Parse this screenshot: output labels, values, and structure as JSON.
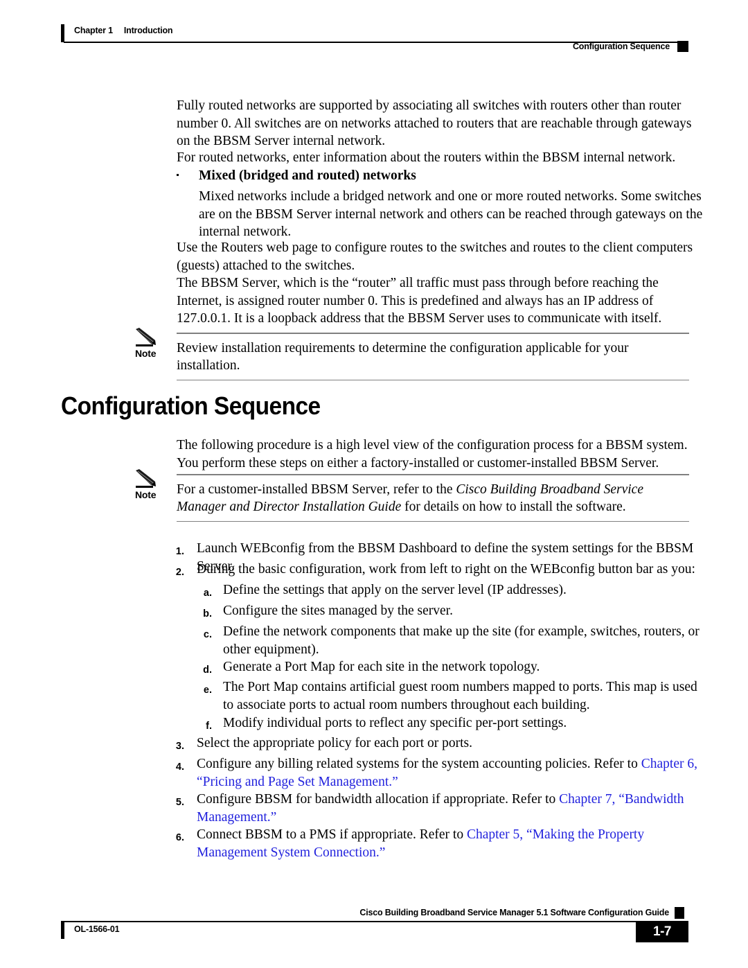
{
  "header": {
    "chapter_number": "Chapter 1",
    "chapter_title": "Introduction",
    "running_head": "Configuration Sequence"
  },
  "body": {
    "para_fully_routed": "Fully routed networks are supported by associating all switches with routers other than router number 0. All switches are on networks attached to routers that are reachable through gateways on the BBSM Server internal network.",
    "para_for_routed": "For routed networks, enter information about the routers within the BBSM internal network.",
    "bullet_mixed_title": "Mixed (bridged and routed) networks",
    "para_mixed_body": "Mixed networks include a bridged network and one or more routed networks. Some switches are on the BBSM Server internal network and others can be reached through gateways on the internal network.",
    "para_use_routers": "Use the Routers web page to configure routes to the switches and routes to the client computers (guests) attached to the switches.",
    "para_bbsm_router0": "The BBSM Server, which is the “router” all traffic must pass through before reaching the Internet, is assigned router number 0. This is predefined and always has an IP address of 127.0.0.1. It is a loopback address that the BBSM Server uses to communicate with itself."
  },
  "note1": {
    "label": "Note",
    "text": "Review installation requirements to determine the configuration applicable for your installation."
  },
  "section": {
    "heading": "Configuration Sequence",
    "intro": "The following procedure is a high level view of the configuration process for a BBSM system. You perform these steps on either a factory-installed or customer-installed BBSM Server."
  },
  "note2": {
    "label": "Note",
    "text_before": "For a customer-installed BBSM Server, refer to the ",
    "text_italic": "Cisco Building Broadband Service Manager and Director Installation Guide",
    "text_after": " for details on how to install the software."
  },
  "steps": [
    {
      "marker": "1.",
      "level": 1,
      "text": "Launch WEBconfig from the BBSM Dashboard to define the system settings for the BBSM Server."
    },
    {
      "marker": "2.",
      "level": 1,
      "text": "During the basic configuration, work from left to right on the WEBconfig button bar as you:"
    },
    {
      "marker": "a.",
      "level": 2,
      "text": "Define the settings that apply on the server level (IP addresses)."
    },
    {
      "marker": "b.",
      "level": 2,
      "text": "Configure the sites managed by the server."
    },
    {
      "marker": "c.",
      "level": 2,
      "text": "Define the network components that make up the site (for example, switches, routers, or other equipment)."
    },
    {
      "marker": "d.",
      "level": 2,
      "text": "Generate a Port Map for each site in the network topology."
    },
    {
      "marker": "e.",
      "level": 2,
      "text": "The Port Map contains artificial guest room numbers mapped to ports. This map is used to associate ports to actual room numbers throughout each building."
    },
    {
      "marker": "f.",
      "level": 2,
      "text": "Modify individual ports to reflect any specific per-port settings."
    },
    {
      "marker": "3.",
      "level": 1,
      "text": "Select the appropriate policy for each port or ports."
    },
    {
      "marker": "4.",
      "level": 1,
      "text_plain": "Configure any billing related systems for the system accounting policies. Refer to ",
      "text_link": "Chapter 6, “Pricing and Page Set Management.”"
    },
    {
      "marker": "5.",
      "level": 1,
      "text_plain": "Configure BBSM for bandwidth allocation if appropriate. Refer to ",
      "text_link": "Chapter 7, “Bandwidth Management.”"
    },
    {
      "marker": "6.",
      "level": 1,
      "text_plain": "Connect BBSM to a PMS if appropriate. Refer to ",
      "text_link": "Chapter 5, “Making the Property Management System Connection.”"
    }
  ],
  "footer": {
    "guide_title": "Cisco Building Broadband Service Manager 5.1 Software Configuration Guide",
    "doc_id": "OL-1566-01",
    "page_number": "1-7"
  },
  "colors": {
    "link": "#2222DD",
    "text": "#000000",
    "rule": "#808080"
  }
}
